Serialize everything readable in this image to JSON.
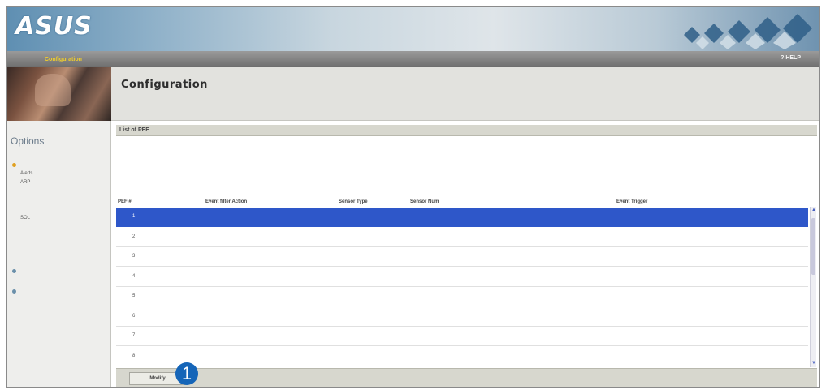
{
  "banner": {
    "logo": "ASUS",
    "logo_sub": "",
    "links": ""
  },
  "nav": {
    "items": [
      {
        "label": "",
        "active": false
      },
      {
        "label": "",
        "active": false
      },
      {
        "label": "Configuration",
        "active": true
      },
      {
        "label": "",
        "active": false
      },
      {
        "label": "",
        "active": false
      },
      {
        "label": "",
        "active": false
      }
    ],
    "help": "HELP"
  },
  "header": {
    "title": "Configuration",
    "description": ""
  },
  "sidebar": {
    "title": "Options",
    "items": [
      {
        "label": "",
        "kind": "main",
        "bullet": "#e0a020"
      },
      {
        "label": "Alerts",
        "kind": "sub"
      },
      {
        "label": "ARP",
        "kind": "sub"
      },
      {
        "label": "",
        "kind": "sub"
      },
      {
        "label": "",
        "kind": "sub"
      },
      {
        "label": "",
        "kind": "sub"
      },
      {
        "label": "SOL",
        "kind": "sub"
      },
      {
        "label": "",
        "kind": "sub"
      },
      {
        "label": "",
        "kind": "sub"
      },
      {
        "label": "",
        "kind": "sub"
      },
      {
        "label": "",
        "kind": "sub"
      },
      {
        "label": "",
        "kind": "main",
        "bullet": "#6a8faa"
      },
      {
        "label": "",
        "kind": "main",
        "bullet": "#6a8faa"
      }
    ]
  },
  "main": {
    "section_title": "List of PEF",
    "instructions": "",
    "table_count": "",
    "columns": [
      "PEF #",
      "Event filter Action",
      "Sensor Type",
      "Sensor Num",
      "Event Trigger"
    ],
    "rows": [
      {
        "num": "1",
        "action": "",
        "type": "",
        "sensor": "",
        "trigger": ""
      },
      {
        "num": "2",
        "action": "",
        "type": "",
        "sensor": "",
        "trigger": ""
      },
      {
        "num": "3",
        "action": "",
        "type": "",
        "sensor": "",
        "trigger": ""
      },
      {
        "num": "4",
        "action": "",
        "type": "",
        "sensor": "",
        "trigger": ""
      },
      {
        "num": "5",
        "action": "",
        "type": "",
        "sensor": "",
        "trigger": ""
      },
      {
        "num": "6",
        "action": "",
        "type": "",
        "sensor": "",
        "trigger": ""
      },
      {
        "num": "7",
        "action": "",
        "type": "",
        "sensor": "",
        "trigger": ""
      },
      {
        "num": "8",
        "action": "",
        "type": "",
        "sensor": "",
        "trigger": ""
      }
    ],
    "selected_row": 0,
    "modify_label": "Modify"
  },
  "callout": "1",
  "colors": {
    "selection": "#2e57c9",
    "nav_active": "#f2cf2a",
    "callout": "#1565b8"
  }
}
